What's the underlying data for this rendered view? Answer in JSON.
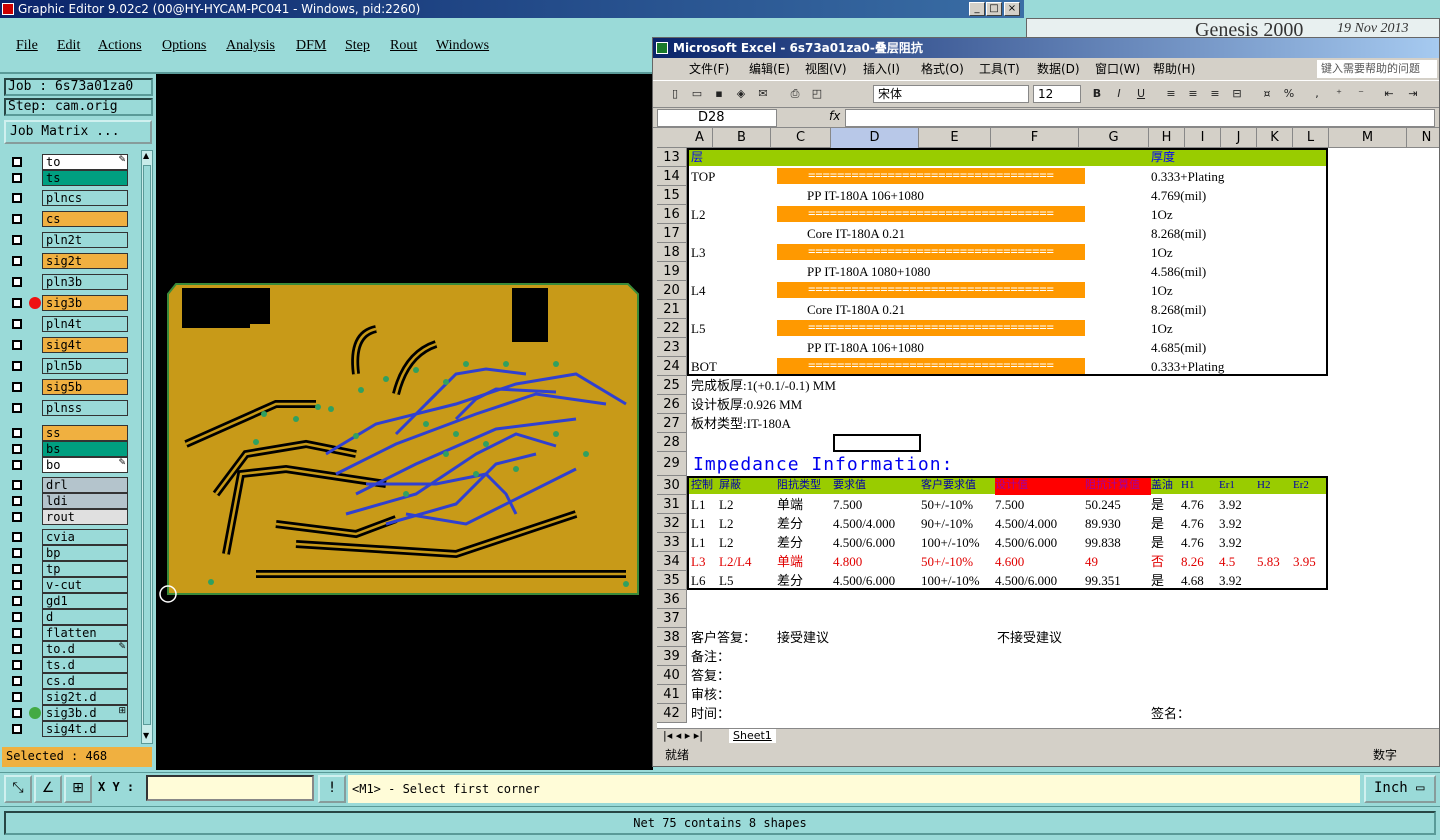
{
  "window": {
    "title": "Graphic Editor 9.02c2 (00@HY-HYCAM-PC041 - Windows, pid:2260)"
  },
  "menu": [
    "File",
    "Edit",
    "Actions",
    "Options",
    "Analysis",
    "DFM",
    "Step",
    "Rout",
    "Windows"
  ],
  "genesis_logo": {
    "name": "Genesis 2000",
    "date": "19 Nov 2013"
  },
  "job": {
    "job_label": "Job : 6s73a01za0",
    "step_label": "Step: cam.orig",
    "matrix_button": "Job Matrix ..."
  },
  "layers": [
    {
      "name": "to",
      "color": "#ffffff",
      "flag": "✎"
    },
    {
      "name": "ts",
      "color": "#009f80",
      "flag": ""
    },
    {
      "name": "plncs",
      "color": "#9adad8",
      "flag": ""
    },
    {
      "name": "cs",
      "color": "#f0b040",
      "flag": ""
    },
    {
      "name": "pln2t",
      "color": "#9adad8",
      "flag": ""
    },
    {
      "name": "sig2t",
      "color": "#f0b040",
      "flag": ""
    },
    {
      "name": "pln3b",
      "color": "#9adad8",
      "flag": ""
    },
    {
      "name": "sig3b",
      "color": "#f0b040",
      "flag": "",
      "dot": "#ee1111"
    },
    {
      "name": "pln4t",
      "color": "#9adad8",
      "flag": ""
    },
    {
      "name": "sig4t",
      "color": "#f0b040",
      "flag": ""
    },
    {
      "name": "pln5b",
      "color": "#9adad8",
      "flag": ""
    },
    {
      "name": "sig5b",
      "color": "#f0b040",
      "flag": ""
    },
    {
      "name": "plnss",
      "color": "#9adad8",
      "flag": ""
    },
    {
      "name": "ss",
      "color": "#f0b040",
      "flag": ""
    },
    {
      "name": "bs",
      "color": "#009f80",
      "flag": ""
    },
    {
      "name": "bo",
      "color": "#ffffff",
      "flag": "✎"
    },
    {
      "name": "drl",
      "color": "#b4c4cc",
      "flag": ""
    },
    {
      "name": "ldi",
      "color": "#b4c4cc",
      "flag": ""
    },
    {
      "name": "rout",
      "color": "#e0e0e0",
      "flag": ""
    },
    {
      "name": "cvia",
      "color": "#9adad8",
      "flag": ""
    },
    {
      "name": "bp",
      "color": "#9adad8",
      "flag": ""
    },
    {
      "name": "tp",
      "color": "#9adad8",
      "flag": ""
    },
    {
      "name": "v-cut",
      "color": "#9adad8",
      "flag": ""
    },
    {
      "name": "gd1",
      "color": "#9adad8",
      "flag": ""
    },
    {
      "name": "d",
      "color": "#9adad8",
      "flag": ""
    },
    {
      "name": "flatten",
      "color": "#9adad8",
      "flag": ""
    },
    {
      "name": "to.d",
      "color": "#9adad8",
      "flag": "✎"
    },
    {
      "name": "ts.d",
      "color": "#9adad8",
      "flag": ""
    },
    {
      "name": "cs.d",
      "color": "#9adad8",
      "flag": ""
    },
    {
      "name": "sig2t.d",
      "color": "#9adad8",
      "flag": ""
    },
    {
      "name": "sig3b.d",
      "color": "#9adad8",
      "flag": "⊞",
      "dot": "#44aa44"
    },
    {
      "name": "sig4t.d",
      "color": "#9adad8",
      "flag": ""
    }
  ],
  "selected": "Selected : 468",
  "excel": {
    "title": "Microsoft Excel - 6s73a01za0-叠层阻抗",
    "menu": [
      "文件(F)",
      "编辑(E)",
      "视图(V)",
      "插入(I)",
      "格式(O)",
      "工具(T)",
      "数据(D)",
      "窗口(W)",
      "帮助(H)"
    ],
    "help_placeholder": "键入需要帮助的问题",
    "font": "宋体",
    "font_size": "12",
    "namebox": "D28",
    "fx": "fx",
    "columns": [
      "A",
      "B",
      "C",
      "D",
      "E",
      "F",
      "G",
      "H",
      "I",
      "J",
      "K",
      "L",
      "M",
      "N"
    ],
    "stackup_header": {
      "layer": "层",
      "thickness": "厚度"
    },
    "stackup_rows": [
      {
        "row": "14",
        "layer": "TOP",
        "bar": true,
        "mid": "",
        "thickness": "0.333+Plating"
      },
      {
        "row": "15",
        "layer": "",
        "bar": false,
        "mid": "PP      IT-180A     106+1080",
        "thickness": "4.769(mil)"
      },
      {
        "row": "16",
        "layer": "L2",
        "bar": true,
        "mid": "",
        "thickness": "1Oz"
      },
      {
        "row": "17",
        "layer": "",
        "bar": false,
        "mid": "Core      IT-180A     0.21",
        "thickness": "8.268(mil)"
      },
      {
        "row": "18",
        "layer": "L3",
        "bar": true,
        "mid": "",
        "thickness": "1Oz"
      },
      {
        "row": "19",
        "layer": "",
        "bar": false,
        "mid": "PP      IT-180A     1080+1080",
        "thickness": "4.586(mil)"
      },
      {
        "row": "20",
        "layer": "L4",
        "bar": true,
        "mid": "",
        "thickness": "1Oz"
      },
      {
        "row": "21",
        "layer": "",
        "bar": false,
        "mid": "Core      IT-180A     0.21",
        "thickness": "8.268(mil)"
      },
      {
        "row": "22",
        "layer": "L5",
        "bar": true,
        "mid": "",
        "thickness": "1Oz"
      },
      {
        "row": "23",
        "layer": "",
        "bar": false,
        "mid": "PP      IT-180A     106+1080",
        "thickness": "4.685(mil)"
      },
      {
        "row": "24",
        "layer": "BOT",
        "bar": true,
        "mid": "",
        "thickness": "0.333+Plating"
      }
    ],
    "bar_text": "==================================",
    "notes": [
      {
        "row": "25",
        "text": "完成板厚:1(+0.1/-0.1) MM"
      },
      {
        "row": "26",
        "text": "设计板厚:0.926 MM"
      },
      {
        "row": "27",
        "text": "板材类型:IT-180A"
      },
      {
        "row": "28",
        "text": ""
      }
    ],
    "impedance_title": "Impedance Information:",
    "imp_headers": [
      "控制",
      "屏蔽",
      "阻抗类型",
      "要求值",
      "客户要求值",
      "设计值",
      "阻抗计算值",
      "盖油",
      "H1",
      "Er1",
      "H2",
      "Er2"
    ],
    "imp_rows": [
      {
        "row": "31",
        "cells": [
          "L1",
          "L2",
          "单端",
          "7.500",
          "50+/-10%",
          "7.500",
          "50.245",
          "是",
          "4.76",
          "3.92",
          "",
          ""
        ],
        "red": false
      },
      {
        "row": "32",
        "cells": [
          "L1",
          "L2",
          "差分",
          "4.500/4.000",
          "90+/-10%",
          "4.500/4.000",
          "89.930",
          "是",
          "4.76",
          "3.92",
          "",
          ""
        ],
        "red": false
      },
      {
        "row": "33",
        "cells": [
          "L1",
          "L2",
          "差分",
          "4.500/6.000",
          "100+/-10%",
          "4.500/6.000",
          "99.838",
          "是",
          "4.76",
          "3.92",
          "",
          ""
        ],
        "red": false
      },
      {
        "row": "34",
        "cells": [
          "L3",
          "L2/L4",
          "单端",
          "4.800",
          "50+/-10%",
          "4.600",
          "49",
          "否",
          "8.26",
          "4.5",
          "5.83",
          "3.95"
        ],
        "red": true
      },
      {
        "row": "35",
        "cells": [
          "L6",
          "L5",
          "差分",
          "4.500/6.000",
          "100+/-10%",
          "4.500/6.000",
          "99.351",
          "是",
          "4.68",
          "3.92",
          "",
          ""
        ],
        "red": false
      }
    ],
    "footer_rows": [
      {
        "row": "36",
        "a": "",
        "c": "",
        "f": "",
        "h": ""
      },
      {
        "row": "37",
        "a": "",
        "c": "",
        "f": "",
        "h": ""
      },
      {
        "row": "38",
        "a": "客户答复：",
        "c": "接受建议",
        "f": "不接受建议",
        "h": ""
      },
      {
        "row": "39",
        "a": "备注：",
        "c": "",
        "f": "",
        "h": ""
      },
      {
        "row": "40",
        "a": "答复：",
        "c": "",
        "f": "",
        "h": ""
      },
      {
        "row": "41",
        "a": "审核：",
        "c": "",
        "f": "",
        "h": ""
      },
      {
        "row": "42",
        "a": "时间：",
        "c": "",
        "f": "",
        "h": "签名："
      }
    ],
    "sheet_tab": "Sheet1",
    "status_left": "就绪",
    "status_right": "数字"
  },
  "cmd": {
    "xy_label": "X Y :",
    "xy_value": "",
    "prompt": "<M1> - Select first corner",
    "units": "Inch"
  },
  "status": "Net 75 contains 8 shapes",
  "colors": {
    "board": "#c89a18",
    "trace": "#3040d0",
    "pad": "#30a060",
    "orange": "#ff9900",
    "header_green": "#99cc00",
    "red_cell": "#ff0000"
  }
}
